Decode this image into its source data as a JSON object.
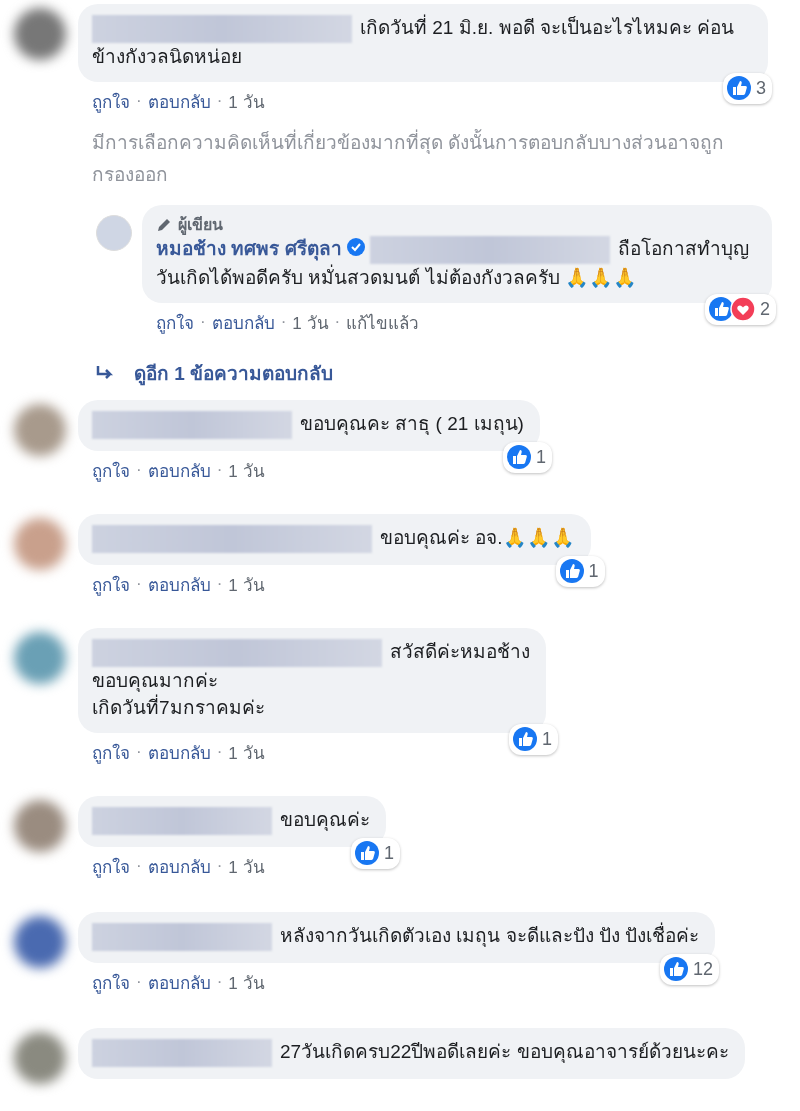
{
  "action_separator": "·",
  "comments": [
    {
      "kind": "comment",
      "text": "เกิดวันที่ 21 มิ.ย. พอดี จะเป็นอะไรไหมคะ ค่อนข้างกังวลนิดหน่อย",
      "reactions": {
        "like": true,
        "count": "3"
      },
      "actions": [
        "ถูกใจ",
        "ตอบกลับ",
        "1 วัน"
      ]
    },
    {
      "kind": "notice",
      "text": "มีการเลือกความคิดเห็นที่เกี่ยวข้องมากที่สุด ดังนั้นการตอบกลับบางส่วนอาจถูกกรองออก"
    },
    {
      "kind": "reply",
      "badge": "ผู้เขียน",
      "name": "หมอช้าง ทศพร ศรีตุลา",
      "verified": true,
      "text": "ถือโอกาสทำบุญวันเกิดได้พอดีครับ หมั่นสวดมนต์ ไม่ต้องกังวลครับ 🙏🙏🙏",
      "reactions": {
        "like": true,
        "love": true,
        "count": "2"
      },
      "actions": [
        "ถูกใจ",
        "ตอบกลับ",
        "1 วัน",
        "แก้ไขแล้ว"
      ]
    },
    {
      "kind": "more",
      "text": "ดูอีก 1 ข้อความตอบกลับ"
    },
    {
      "kind": "comment",
      "text": "ขอบคุณคะ สาธุ ( 21 เมถุน)",
      "reactions": {
        "like": true,
        "count": "1"
      },
      "actions": [
        "ถูกใจ",
        "ตอบกลับ",
        "1 วัน"
      ]
    },
    {
      "kind": "comment",
      "text": "ขอบคุณค่ะ อจ.🙏🙏🙏",
      "reactions": {
        "like": true,
        "count": "1"
      },
      "actions": [
        "ถูกใจ",
        "ตอบกลับ",
        "1 วัน"
      ]
    },
    {
      "kind": "comment",
      "text": "สวัสดีค่ะหมอช้าง\nขอบคุณมากค่ะ\nเกิดวันที่7มกราคมค่ะ",
      "reactions": {
        "like": true,
        "count": "1"
      },
      "actions": [
        "ถูกใจ",
        "ตอบกลับ",
        "1 วัน"
      ]
    },
    {
      "kind": "comment",
      "text": "ขอบคุณค่ะ",
      "reactions": {
        "like": true,
        "count": "1"
      },
      "actions": [
        "ถูกใจ",
        "ตอบกลับ",
        "1 วัน"
      ]
    },
    {
      "kind": "comment",
      "text": "หลังจากวันเกิดตัวเอง เมถุน จะดีและปัง ปัง ปังเชื่อค่ะ",
      "reactions": {
        "like": true,
        "count": "12"
      },
      "actions": [
        "ถูกใจ",
        "ตอบกลับ",
        "1 วัน"
      ]
    },
    {
      "kind": "comment",
      "text": "27วันเกิดครบ22ปีพอดีเลยค่ะ ขอบคุณอาจารย์ด้วยนะคะ"
    }
  ]
}
